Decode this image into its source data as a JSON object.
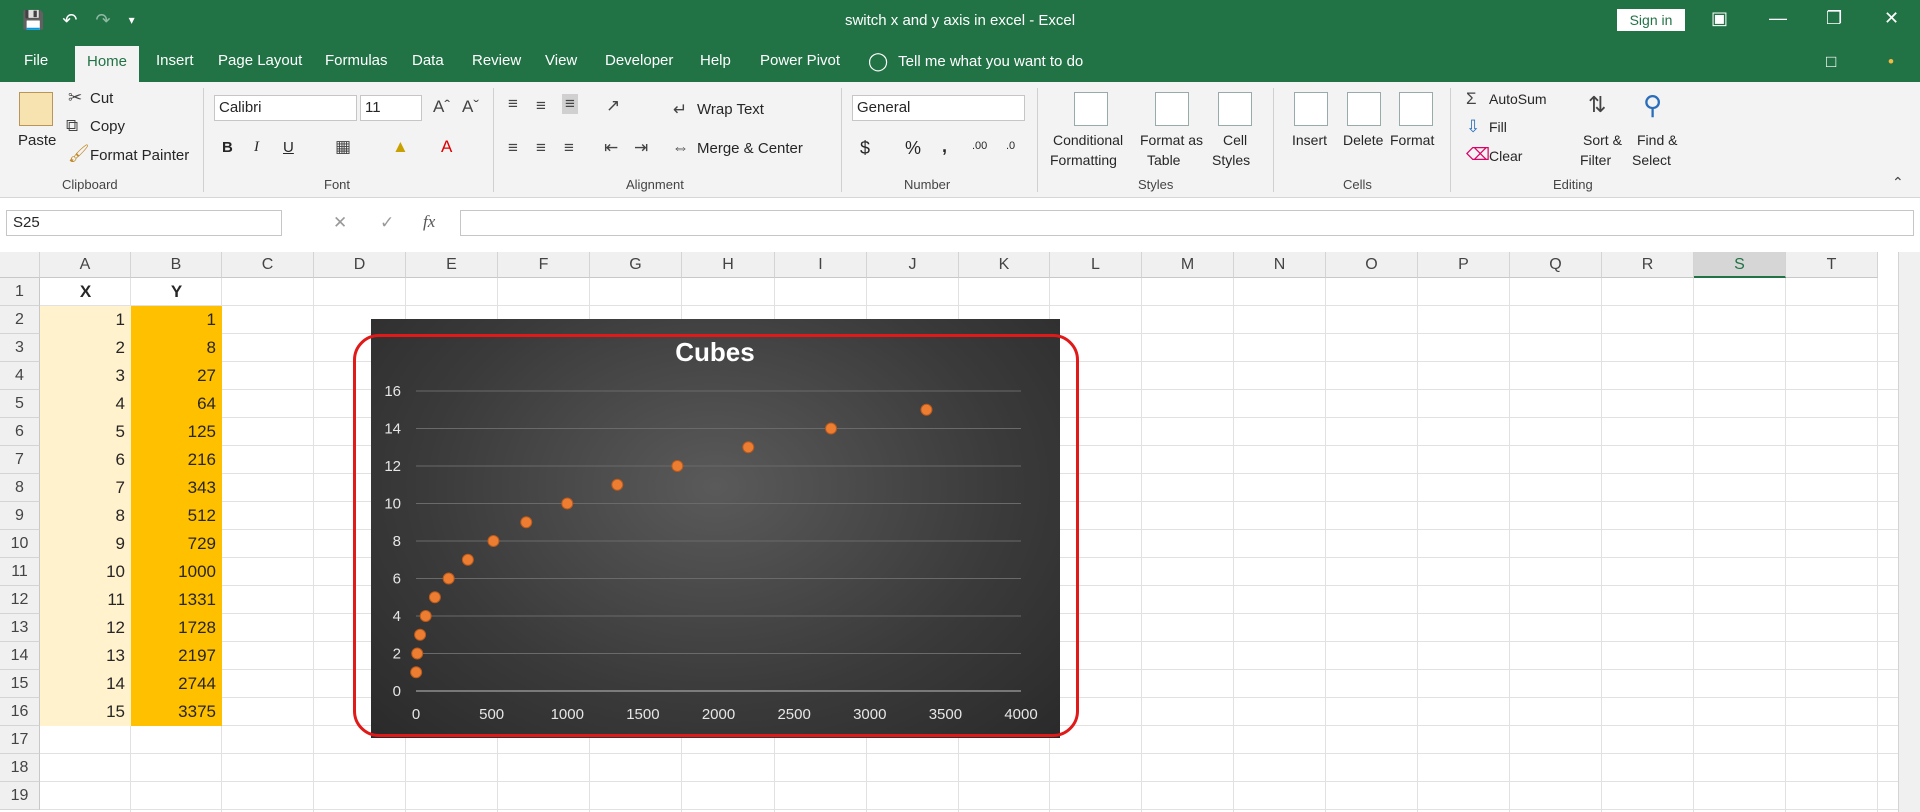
{
  "window": {
    "title": "switch x and y axis in excel  -  Excel",
    "sign_in": "Sign in"
  },
  "tabs": [
    "File",
    "Home",
    "Insert",
    "Page Layout",
    "Formulas",
    "Data",
    "Review",
    "View",
    "Developer",
    "Help",
    "Power Pivot"
  ],
  "tell_me": "Tell me what you want to do",
  "ribbon": {
    "clipboard": {
      "paste": "Paste",
      "cut": "Cut",
      "copy": "Copy",
      "format_painter": "Format Painter",
      "label": "Clipboard"
    },
    "font": {
      "name": "Calibri",
      "size": "11",
      "label": "Font",
      "bold": "B",
      "italic": "I",
      "underline": "U"
    },
    "alignment": {
      "wrap_text": "Wrap Text",
      "merge_center": "Merge & Center",
      "label": "Alignment"
    },
    "number": {
      "format": "General",
      "label": "Number",
      "currency": "$",
      "percent": "%",
      "comma": ",",
      "inc_dec": ".00",
      "dec_dec": ".0"
    },
    "styles": {
      "conditional": "Conditional",
      "formatting": "Formatting",
      "format_as": "Format as",
      "table": "Table",
      "cell": "Cell",
      "cell_styles": "Styles",
      "label": "Styles"
    },
    "cells": {
      "insert": "Insert",
      "delete": "Delete",
      "format": "Format",
      "label": "Cells"
    },
    "editing": {
      "autosum": "AutoSum",
      "fill": "Fill",
      "clear": "Clear",
      "sort": "Sort &",
      "filter": "Filter",
      "find": "Find &",
      "select": "Select",
      "label": "Editing"
    }
  },
  "formula_bar": {
    "name_box": "S25",
    "fx": "fx",
    "value": ""
  },
  "columns": [
    "A",
    "B",
    "C",
    "D",
    "E",
    "F",
    "G",
    "H",
    "I",
    "J",
    "K",
    "L",
    "M",
    "N",
    "O",
    "P",
    "Q",
    "R",
    "S",
    "T"
  ],
  "rows": [
    "1",
    "2",
    "3",
    "4",
    "5",
    "6",
    "7",
    "8",
    "9",
    "10",
    "11",
    "12",
    "13",
    "14",
    "15",
    "16",
    "17",
    "18",
    "19"
  ],
  "table": {
    "header_x": "X",
    "header_y": "Y",
    "x": [
      "1",
      "2",
      "3",
      "4",
      "5",
      "6",
      "7",
      "8",
      "9",
      "10",
      "11",
      "12",
      "13",
      "14",
      "15"
    ],
    "y": [
      "1",
      "8",
      "27",
      "64",
      "125",
      "216",
      "343",
      "512",
      "729",
      "1000",
      "1331",
      "1728",
      "2197",
      "2744",
      "3375"
    ]
  },
  "colors": {
    "excel_green": "#217346",
    "x_fill": "#fff2cc",
    "y_fill": "#ffc000",
    "point": "#ed7d31",
    "highlight": "#e01919"
  },
  "chart_data": {
    "type": "scatter",
    "title": "Cubes",
    "x": [
      1,
      8,
      27,
      64,
      125,
      216,
      343,
      512,
      729,
      1000,
      1331,
      1728,
      2197,
      2744,
      3375
    ],
    "y": [
      1,
      2,
      3,
      4,
      5,
      6,
      7,
      8,
      9,
      10,
      11,
      12,
      13,
      14,
      15
    ],
    "xlim": [
      0,
      4000
    ],
    "ylim": [
      0,
      16
    ],
    "xticks": [
      "0",
      "500",
      "1000",
      "1500",
      "2000",
      "2500",
      "3000",
      "3500",
      "4000"
    ],
    "yticks": [
      "0",
      "2",
      "4",
      "6",
      "8",
      "10",
      "12",
      "14",
      "16"
    ],
    "grid": "horizontal"
  }
}
